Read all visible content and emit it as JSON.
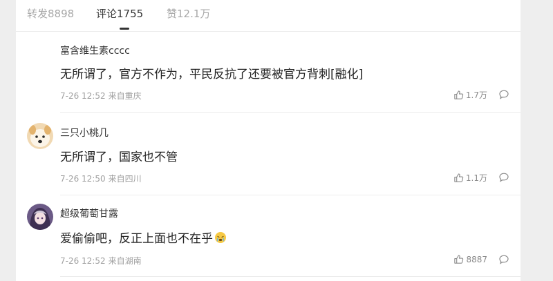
{
  "tabs": [
    {
      "label": "转发8898"
    },
    {
      "label": "评论1755"
    },
    {
      "label": "赞12.1万"
    }
  ],
  "comments": [
    {
      "username": "富含维生素cccc",
      "text": "无所谓了，官方不作为，平民反抗了还要被官方背刺[融化]",
      "time": "7-26 12:52",
      "location": "来自重庆",
      "likes": "1.7万",
      "avatar": "none"
    },
    {
      "username": "三只小桃几",
      "text": "无所谓了，国家也不管",
      "time": "7-26 12:50",
      "location": "来自四川",
      "likes": "1.1万",
      "avatar": "dog-photo"
    },
    {
      "username": "超级葡萄甘露",
      "text": "爱偷偷吧，反正上面也不在乎",
      "time": "7-26 12:52",
      "location": "来自湖南",
      "likes": "8887",
      "avatar": "anime-character"
    }
  ],
  "icons": {
    "like": "thumbs-up-icon",
    "reply": "comment-bubble-icon",
    "emoji": "crying-face-emoji"
  },
  "colors": {
    "background": "#eeeeee",
    "panel": "#ffffff",
    "text": "#222222",
    "muted": "#a0a0a0"
  }
}
